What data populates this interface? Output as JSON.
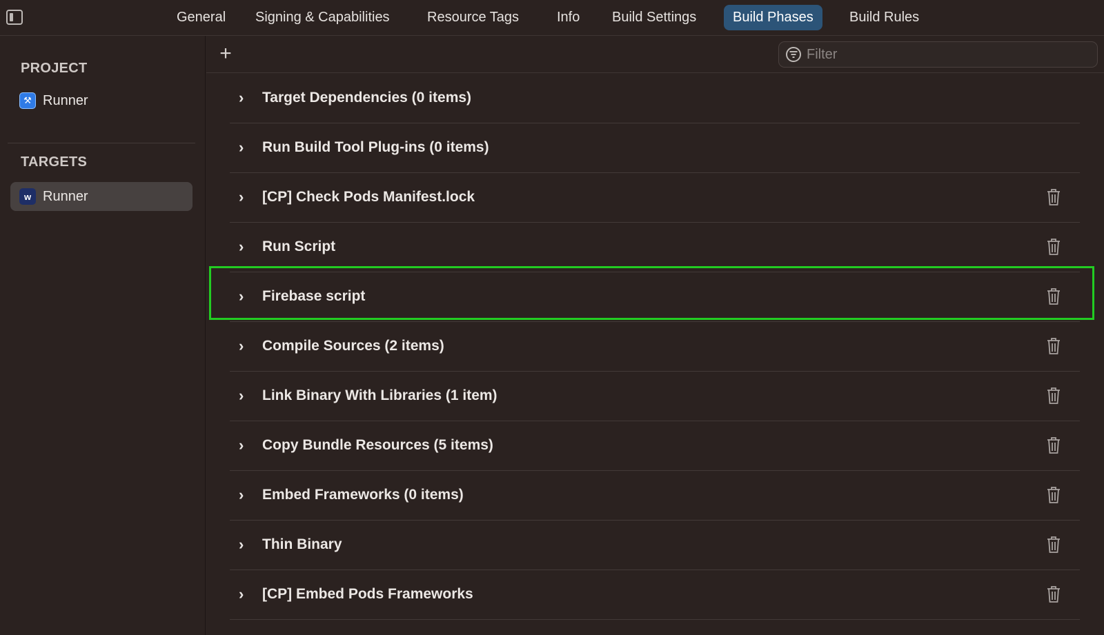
{
  "tabs": [
    {
      "label": "General",
      "active": false
    },
    {
      "label": "Signing & Capabilities",
      "active": false
    },
    {
      "label": "Resource Tags",
      "active": false
    },
    {
      "label": "Info",
      "active": false
    },
    {
      "label": "Build Settings",
      "active": false
    },
    {
      "label": "Build Phases",
      "active": true
    },
    {
      "label": "Build Rules",
      "active": false
    }
  ],
  "sidebar": {
    "project_title": "PROJECT",
    "project_item": "Runner",
    "targets_title": "TARGETS",
    "target_item": "Runner"
  },
  "toolbar": {
    "add_label": "+",
    "filter_placeholder": "Filter"
  },
  "phases": [
    {
      "label": "Target Dependencies (0 items)",
      "deletable": false
    },
    {
      "label": "Run Build Tool Plug-ins (0 items)",
      "deletable": false
    },
    {
      "label": "[CP] Check Pods Manifest.lock",
      "deletable": true
    },
    {
      "label": "Run Script",
      "deletable": true
    },
    {
      "label": "Firebase script",
      "deletable": true,
      "highlighted": true
    },
    {
      "label": "Compile Sources (2 items)",
      "deletable": true
    },
    {
      "label": "Link Binary With Libraries (1 item)",
      "deletable": true
    },
    {
      "label": "Copy Bundle Resources (5 items)",
      "deletable": true
    },
    {
      "label": "Embed Frameworks (0 items)",
      "deletable": true
    },
    {
      "label": "Thin Binary",
      "deletable": true
    },
    {
      "label": "[CP] Embed Pods Frameworks",
      "deletable": true
    }
  ],
  "colors": {
    "background": "#2b2220",
    "active_tab": "#2c5478",
    "selected_row": "#474140",
    "highlight": "#22cc22"
  }
}
